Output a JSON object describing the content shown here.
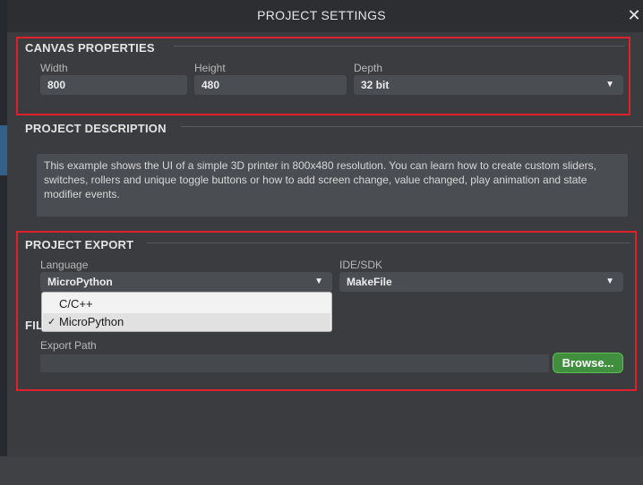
{
  "dialog": {
    "title": "PROJECT SETTINGS",
    "close_glyph": "✕"
  },
  "canvas": {
    "heading": "CANVAS PROPERTIES",
    "width_label": "Width",
    "width_value": "800",
    "height_label": "Height",
    "height_value": "480",
    "depth_label": "Depth",
    "depth_value": "32 bit"
  },
  "description": {
    "heading": "PROJECT DESCRIPTION",
    "text": "This example shows the UI of a simple 3D printer in 800x480 resolution. You can learn how to create custom sliders, switches, rollers and unique toggle buttons or how to add screen change, value changed, play animation and state modifier events."
  },
  "export": {
    "heading": "PROJECT EXPORT",
    "language_label": "Language",
    "language_value": "MicroPython",
    "ide_label": "IDE/SDK",
    "ide_value": "MakeFile",
    "language_options": [
      {
        "label": "C/C++",
        "selected": false
      },
      {
        "label": "MicroPython",
        "selected": true
      }
    ],
    "hidden_heading_fragment": "FIL",
    "export_path_label": "Export Path",
    "export_path_value": "",
    "browse_label": "Browse..."
  },
  "icons": {
    "arrow": "▼",
    "check": "✓"
  },
  "colors": {
    "highlight_border": "#e0202a",
    "browse_button": "#3f8f3f"
  }
}
